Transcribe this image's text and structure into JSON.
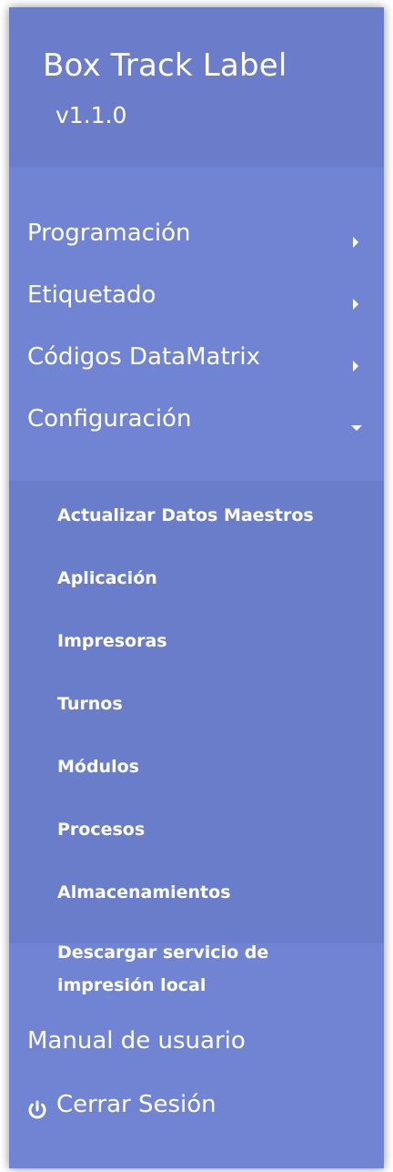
{
  "app": {
    "title": "Box Track Label",
    "version": "v1.1.0"
  },
  "menu": {
    "items": [
      {
        "label": "Programación",
        "state": "collapsed"
      },
      {
        "label": "Etiquetado",
        "state": "collapsed"
      },
      {
        "label": "Códigos DataMatrix",
        "state": "collapsed"
      },
      {
        "label": "Configuración",
        "state": "expanded"
      }
    ],
    "submenu": [
      {
        "label": "Actualizar Datos Maestros"
      },
      {
        "label": "Aplicación"
      },
      {
        "label": "Impresoras"
      },
      {
        "label": "Turnos"
      },
      {
        "label": "Módulos"
      },
      {
        "label": "Procesos"
      },
      {
        "label": "Almacenamientos"
      },
      {
        "label": "Descargar servicio de",
        "label_line2": "impresión local"
      }
    ],
    "manual_label": "Manual de usuario",
    "logout_label": "Cerrar Sesión"
  },
  "colors": {
    "sidebar": "#7184d4",
    "header": "#6b7ccb",
    "submenu": "#6a7dca",
    "text": "#ffffff"
  },
  "icons": {
    "collapsed_indicator": "caret-right-icon",
    "expanded_indicator": "caret-down-icon",
    "logout": "power-icon"
  }
}
